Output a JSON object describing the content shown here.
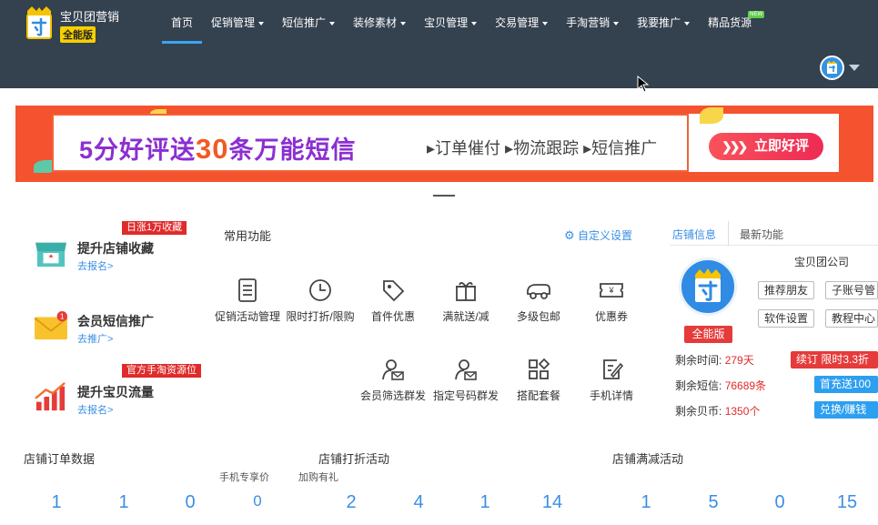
{
  "header": {
    "brand": "宝贝团营销",
    "edition_badge": "全能版",
    "nav": [
      {
        "label": "首页",
        "has_caret": false,
        "active": true
      },
      {
        "label": "促销管理",
        "has_caret": true
      },
      {
        "label": "短信推广",
        "has_caret": true
      },
      {
        "label": "装修素材",
        "has_caret": true
      },
      {
        "label": "宝贝管理",
        "has_caret": true
      },
      {
        "label": "交易管理",
        "has_caret": true
      },
      {
        "label": "手淘营销",
        "has_caret": true
      },
      {
        "label": "我要推广",
        "has_caret": true
      },
      {
        "label": "精品货源",
        "has_caret": false,
        "badge": "NEW"
      }
    ]
  },
  "banner": {
    "title_pre": "5分好评送",
    "title_num": "30",
    "title_post": "条万能短信",
    "subtitle": "▸订单催付 ▸物流跟踪 ▸短信推广",
    "cta": "立即好评"
  },
  "promos": [
    {
      "title": "提升店铺收藏",
      "link": "去报名>",
      "tag": "日涨1万收藏"
    },
    {
      "title": "会员短信推广",
      "link": "去推广>",
      "tag": "",
      "count": "1"
    },
    {
      "title": "提升宝贝流量",
      "link": "去报名>",
      "tag": "官方手淘资源位"
    }
  ],
  "common": {
    "title": "常用功能",
    "customize": "自定义设置",
    "row1": [
      "促销活动管理",
      "限时打折/限购",
      "首件优惠",
      "满就送/减",
      "多级包邮",
      "优惠券"
    ],
    "row2": [
      "会员筛选群发",
      "指定号码群发",
      "搭配套餐",
      "手机详情"
    ],
    "row3_cut": [
      "手机专享价",
      "加购有礼"
    ]
  },
  "shop": {
    "tab_active": "店铺信息",
    "tab_other": "最新功能",
    "name": "宝贝团公司",
    "badge": "全能版",
    "buttons": [
      "推荐朋友",
      "子账号管",
      "软件设置",
      "教程中心"
    ],
    "stats": [
      {
        "label": "剩余时间:",
        "value": "279天",
        "btn": "续订 限时3.3折",
        "btn_color": "#e63b3b"
      },
      {
        "label": "剩余短信:",
        "value": "76689条",
        "btn": "首充送100",
        "btn_color": "#2d9ff0"
      },
      {
        "label": "剩余贝币:",
        "value": "1350个",
        "btn": "兑换/赚钱",
        "btn_color": "#2d9ff0"
      }
    ]
  },
  "data_sections": {
    "titles": [
      "店铺订单数据",
      "店铺打折活动",
      "店铺满减活动"
    ],
    "order_numbers": [
      "1",
      "1",
      "0",
      "0"
    ],
    "discount_numbers": [
      "2",
      "4",
      "1",
      "14"
    ],
    "fullcut_numbers": [
      "1",
      "5",
      "0",
      "15"
    ]
  },
  "colors": {
    "header_bg": "#34414f",
    "accent": "#3a8ee6",
    "danger": "#e02b2b",
    "banner_bg": "#f5522f"
  }
}
